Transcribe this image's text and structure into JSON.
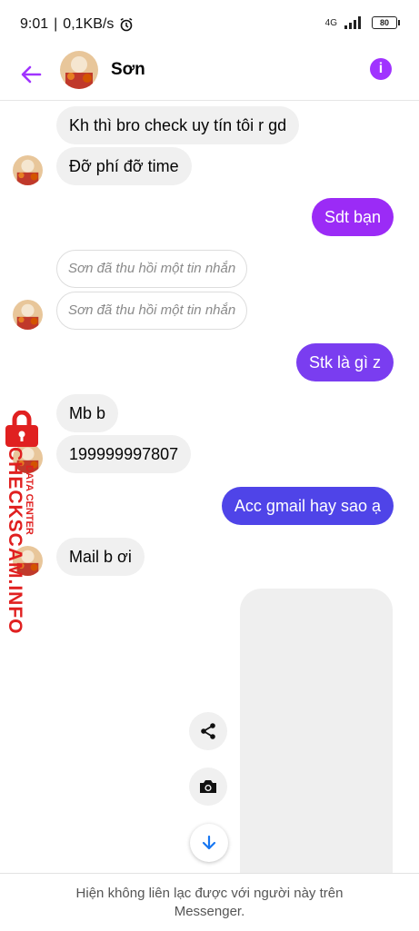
{
  "status": {
    "time": "9:01",
    "speed": "0,1KB/s",
    "network": "4G",
    "battery": "80"
  },
  "header": {
    "name": "Sơn",
    "back_icon": "arrow-left-icon",
    "info_icon": "info-icon"
  },
  "colors": {
    "accent": "#a033ff",
    "out_bubble_1": "#9b2bf6",
    "out_bubble_2": "#7a3df0",
    "out_bubble_3": "#4f44e8"
  },
  "messages": [
    {
      "from": "them",
      "text": "Kh thì bro check uy tín tôi r gd"
    },
    {
      "from": "them",
      "text": "Đỡ phí đỡ time"
    },
    {
      "from": "me",
      "text": "Sdt bạn"
    },
    {
      "from": "them",
      "recalled": true,
      "text": "Sơn đã thu hồi một tin nhắn"
    },
    {
      "from": "them",
      "recalled": true,
      "text": "Sơn đã thu hồi một tin nhắn"
    },
    {
      "from": "me",
      "text": "Stk là gì z"
    },
    {
      "from": "them",
      "text": "Mb b"
    },
    {
      "from": "them",
      "text": "199999997807"
    },
    {
      "from": "me",
      "text": "Acc gmail hay sao ạ"
    },
    {
      "from": "them",
      "text": "Mail b ơi"
    }
  ],
  "watermark": {
    "main": "CHECKSCAM.INFO",
    "sub": "DATA CENTER"
  },
  "footer": {
    "text": "Hiện không liên lạc được với người này trên Messenger."
  }
}
